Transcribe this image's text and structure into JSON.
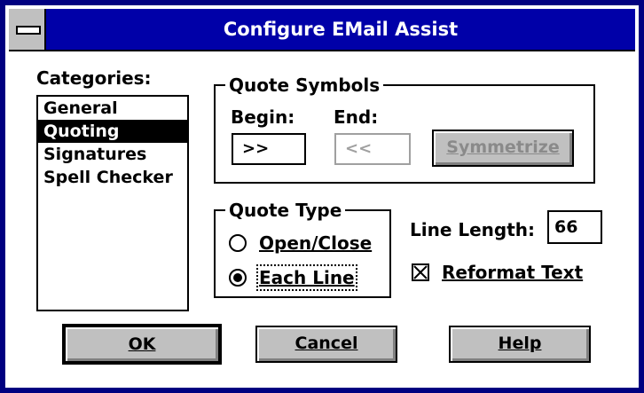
{
  "window": {
    "title": "Configure EMail Assist"
  },
  "categories": {
    "label": "Categories:",
    "items": [
      {
        "label": "General",
        "selected": false
      },
      {
        "label": "Quoting",
        "selected": true
      },
      {
        "label": "Signatures",
        "selected": false
      },
      {
        "label": "Spell Checker",
        "selected": false
      }
    ]
  },
  "quote_symbols": {
    "group_title": "Quote Symbols",
    "begin_label": "Begin:",
    "end_label": "End:",
    "begin_value": ">>",
    "end_value": "<<",
    "symmetrize_label": "Symmetrize"
  },
  "quote_type": {
    "group_title": "Quote Type",
    "options": [
      {
        "label": "Open/Close",
        "selected": false
      },
      {
        "label": "Each Line",
        "selected": true
      }
    ]
  },
  "line_length": {
    "label": "Line Length:",
    "value": "66"
  },
  "reformat_text": {
    "label": "Reformat Text",
    "checked": true
  },
  "buttons": {
    "ok": "OK",
    "cancel": "Cancel",
    "help": "Help"
  },
  "colors": {
    "titlebar": "#0000a8",
    "frame": "#000080",
    "button_face": "#c0c0c0",
    "disabled_text": "#a0a0a0"
  }
}
